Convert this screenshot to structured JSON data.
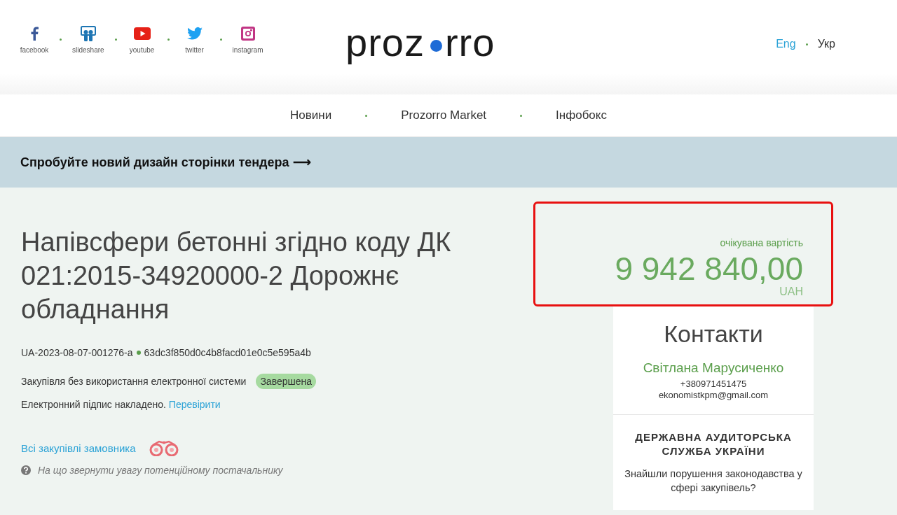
{
  "header": {
    "social_links": [
      {
        "label": "facebook",
        "kind": "facebook"
      },
      {
        "label": "slideshare",
        "kind": "slideshare"
      },
      {
        "label": "youtube",
        "kind": "youtube"
      },
      {
        "label": "twitter",
        "kind": "twitter"
      },
      {
        "label": "instagram",
        "kind": "instagram"
      }
    ],
    "logo": {
      "left": "proz",
      "right": "rro"
    },
    "languages": [
      {
        "label": "Eng",
        "selected": false
      },
      {
        "label": "Укр",
        "selected": true
      }
    ]
  },
  "nav": {
    "items": [
      "Новини",
      "Prozorro Market",
      "Інфобокс"
    ]
  },
  "banner": {
    "text": "Спробуйте новий дизайн сторінки тендера",
    "arrow": "⟶"
  },
  "tender": {
    "title": "Напівсфери бетонні згідно коду ДК 021:2015-34920000-2 Дорожнє обладнання",
    "id": "UA-2023-08-07-001276-a",
    "hash": "63dc3f850d0c4b8facd01e0c5e595a4b",
    "procurement_type": "Закупівля без використання електронної системи",
    "status": "Завершена",
    "signature_text": "Електронний підпис накладено.",
    "signature_link": "Перевірити",
    "buyer_link": "Всі закупівлі замовника",
    "hint": "На що звернути увагу потенційному постачальнику"
  },
  "price": {
    "label": "очікувана вартість",
    "amount": "9 942 840,00",
    "currency": "UAH",
    "highlighted": true
  },
  "contacts": {
    "title": "Контакти",
    "name": "Світлана Марусиченко",
    "phone": "+380971451475",
    "email": "ekonomistkpm@gmail.com"
  },
  "audit": {
    "title": "ДЕРЖАВНА АУДИТОРСЬКА СЛУЖБА УКРАЇНИ",
    "question": "Знайшли порушення законодавства у сфері закупівель?"
  }
}
